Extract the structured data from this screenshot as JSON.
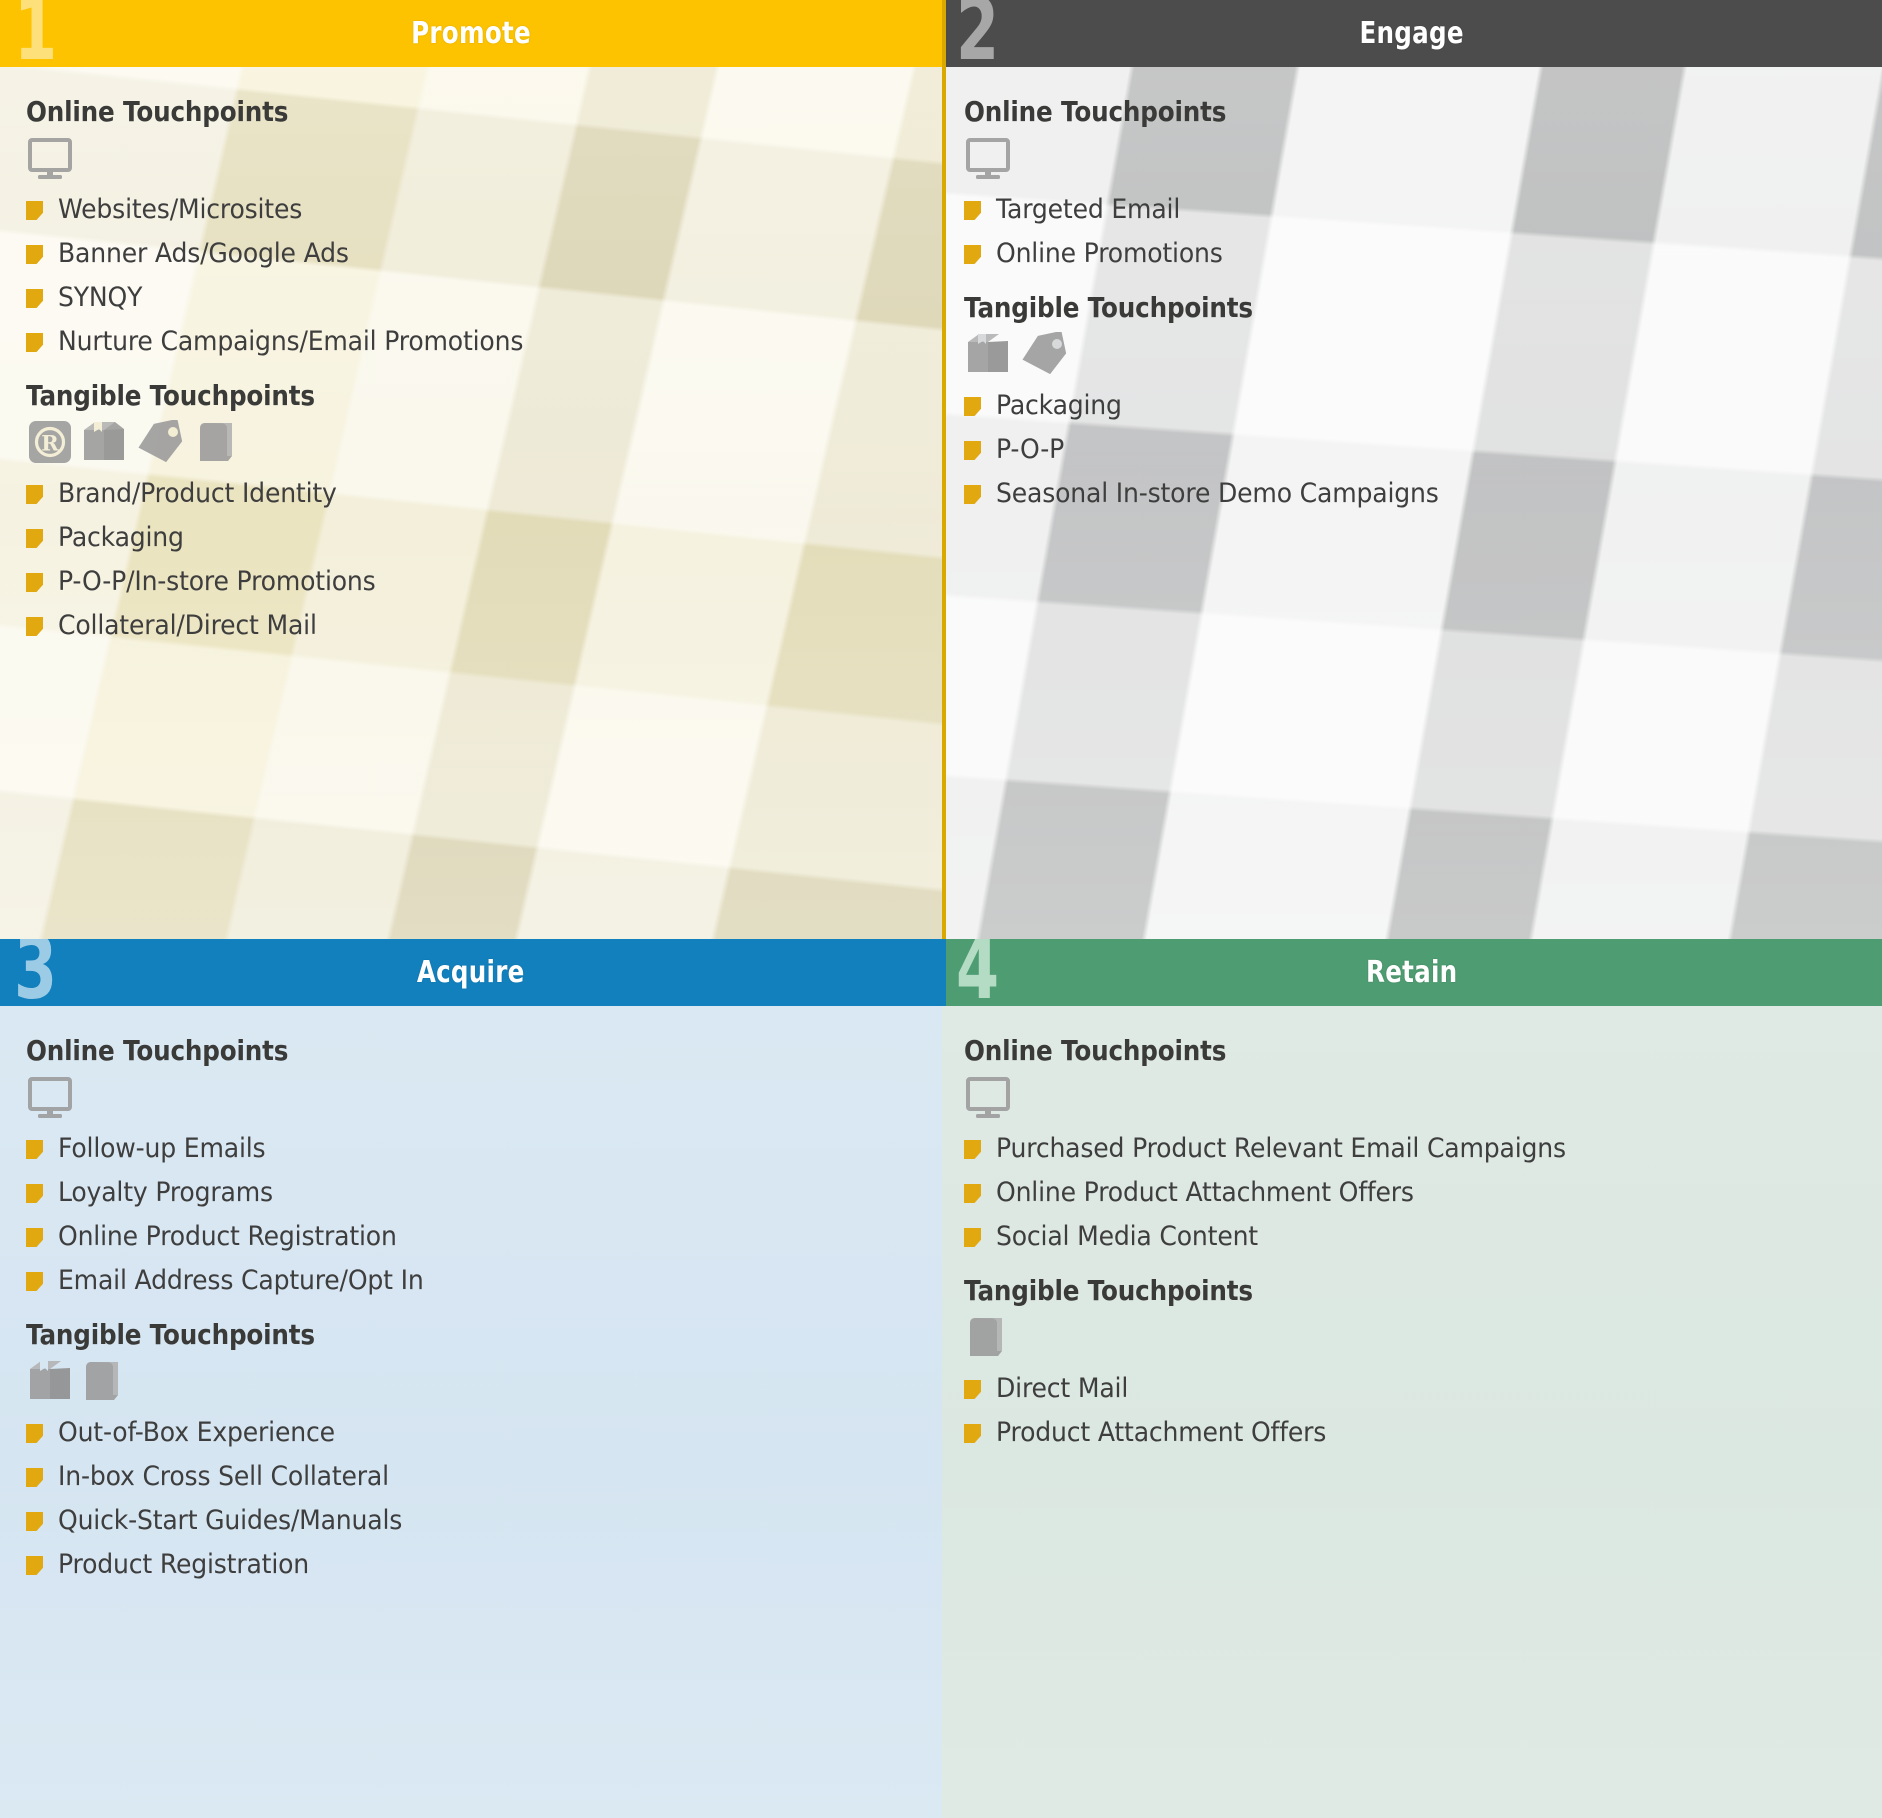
{
  "colors": {
    "promote": "#fdc300",
    "engage": "#4c4c4c",
    "acquire": "#1280bd",
    "retain": "#4e9c72",
    "bullet": "#e2a810",
    "icon": "#9a9a9a"
  },
  "section_labels": {
    "online": "Online Touchpoints",
    "tangible": "Tangible Touchpoints"
  },
  "panels": [
    {
      "number": "1",
      "title": "Promote",
      "online": {
        "heading": "Online Touchpoints",
        "icons": [
          "monitor-icon"
        ],
        "items": [
          "Websites/Microsites",
          "Banner Ads/Google Ads",
          "SYNQY",
          "Nurture Campaigns/Email Promotions"
        ]
      },
      "tangible": {
        "heading": "Tangible Touchpoints",
        "icons": [
          "registered-trademark-icon",
          "box-icon",
          "tag-icon",
          "book-icon"
        ],
        "items": [
          "Brand/Product Identity",
          "Packaging",
          "P-O-P/In-store Promotions",
          "Collateral/Direct Mail"
        ]
      }
    },
    {
      "number": "2",
      "title": "Engage",
      "online": {
        "heading": "Online Touchpoints",
        "icons": [
          "monitor-icon"
        ],
        "items": [
          "Targeted Email",
          "Online Promotions"
        ]
      },
      "tangible": {
        "heading": "Tangible Touchpoints",
        "icons": [
          "box-icon",
          "tag-icon"
        ],
        "items": [
          "Packaging",
          "P-O-P",
          "Seasonal In-store Demo Campaigns"
        ]
      }
    },
    {
      "number": "3",
      "title": "Acquire",
      "online": {
        "heading": "Online Touchpoints",
        "icons": [
          "monitor-icon"
        ],
        "items": [
          "Follow-up Emails",
          "Loyalty Programs",
          "Online Product Registration",
          "Email Address Capture/Opt In"
        ]
      },
      "tangible": {
        "heading": "Tangible Touchpoints",
        "icons": [
          "box-icon",
          "book-icon"
        ],
        "items": [
          "Out-of-Box Experience",
          "In-box Cross Sell Collateral",
          "Quick-Start Guides/Manuals",
          "Product Registration"
        ]
      }
    },
    {
      "number": "4",
      "title": "Retain",
      "online": {
        "heading": "Online Touchpoints",
        "icons": [
          "monitor-icon"
        ],
        "items": [
          "Purchased Product Relevant Email Campaigns",
          "Online Product Attachment Offers",
          "Social Media Content"
        ]
      },
      "tangible": {
        "heading": "Tangible Touchpoints",
        "icons": [
          "book-icon"
        ],
        "items": [
          "Direct Mail",
          "Product Attachment Offers"
        ]
      }
    }
  ]
}
